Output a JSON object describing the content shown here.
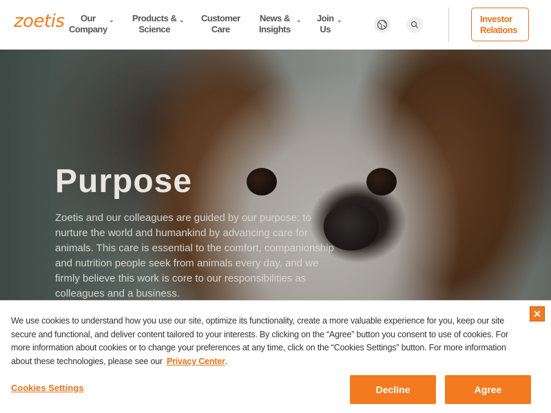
{
  "brand": {
    "logo_text": "zoetis",
    "accent": "#f47a1f"
  },
  "nav": {
    "items": [
      {
        "label_line1": "Our",
        "label_line2": "Company",
        "has_dropdown": true
      },
      {
        "label_line1": "Products &",
        "label_line2": "Science",
        "has_dropdown": true
      },
      {
        "label_line1": "Customer",
        "label_line2": "Care",
        "has_dropdown": false
      },
      {
        "label_line1": "News &",
        "label_line2": "Insights",
        "has_dropdown": true
      },
      {
        "label_line1": "Join",
        "label_line2": "Us",
        "has_dropdown": true
      }
    ],
    "icons": [
      "globe-icon",
      "search-icon"
    ],
    "investor": {
      "line1": "Investor",
      "line2": "Relations"
    }
  },
  "hero": {
    "title": "Purpose",
    "body": "Zoetis and our colleagues are guided by our purpose: to nurture the world and humankind by advancing care for animals. This care is essential to the comfort, companionship and nutrition people seek from animals every day, and we firmly believe this work is core to our responsibilities as colleagues and a business."
  },
  "cookie_banner": {
    "text": "We use cookies to understand how you use our site, optimize its functionality, create a more valuable experience for you, keep our site secure and functional, and deliver content tailored to your interests. By clicking on the “Agree” button you consent to use of cookies. For more information about cookies or to change your preferences at any time, click on the “Cookies Settings” button. For more information about these technologies, please see our",
    "privacy_link": "Privacy Center",
    "trailing": ".",
    "settings_label": "Cookies Settings",
    "decline_label": "Decline",
    "agree_label": "Agree",
    "close_glyph": "✕"
  }
}
